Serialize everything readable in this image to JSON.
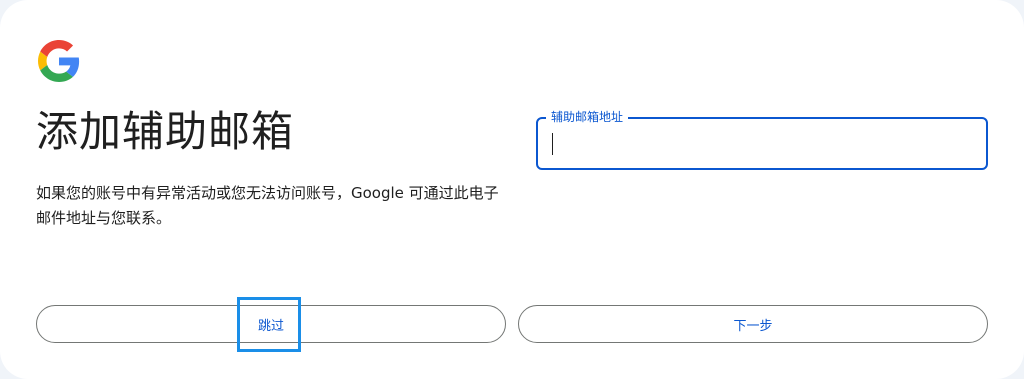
{
  "header": {
    "logo_icon": "google-g-logo-icon",
    "title": "添加辅助邮箱",
    "description": "如果您的账号中有异常活动或您无法访问账号，Google 可通过此电子邮件地址与您联系。"
  },
  "form": {
    "email_label": "辅助邮箱地址",
    "email_value": ""
  },
  "actions": {
    "skip_label": "跳过",
    "next_label": "下一步"
  },
  "colors": {
    "accent": "#0b57d0",
    "highlight": "#1a8ee8",
    "text": "#1f1f1f",
    "border": "#747775"
  }
}
